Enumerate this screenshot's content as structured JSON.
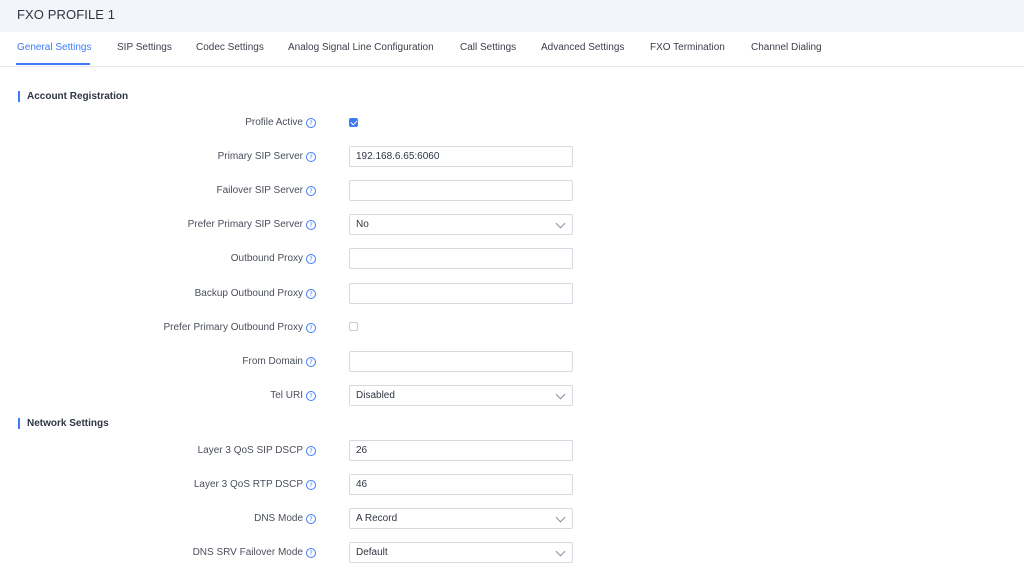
{
  "header": {
    "title": "FXO PROFILE 1"
  },
  "tabs": [
    {
      "label": "General Settings"
    },
    {
      "label": "SIP Settings"
    },
    {
      "label": "Codec Settings"
    },
    {
      "label": "Analog Signal Line Configuration"
    },
    {
      "label": "Call Settings"
    },
    {
      "label": "Advanced Settings"
    },
    {
      "label": "FXO Termination"
    },
    {
      "label": "Channel Dialing"
    }
  ],
  "sections": {
    "account": "Account Registration",
    "network": "Network Settings"
  },
  "fields": {
    "profile_active": {
      "label": "Profile Active",
      "checked": true
    },
    "primary_sip": {
      "label": "Primary SIP Server",
      "value": "192.168.6.65:6060"
    },
    "failover_sip": {
      "label": "Failover SIP Server",
      "value": ""
    },
    "prefer_primary_sip": {
      "label": "Prefer Primary SIP Server",
      "value": "No"
    },
    "outbound_proxy": {
      "label": "Outbound Proxy",
      "value": ""
    },
    "backup_outbound_proxy": {
      "label": "Backup Outbound Proxy",
      "value": ""
    },
    "prefer_primary_outbound": {
      "label": "Prefer Primary Outbound Proxy",
      "checked": false
    },
    "from_domain": {
      "label": "From Domain",
      "value": ""
    },
    "tel_uri": {
      "label": "Tel URI",
      "value": "Disabled"
    },
    "qos_sip": {
      "label": "Layer 3 QoS SIP DSCP",
      "value": "26"
    },
    "qos_rtp": {
      "label": "Layer 3 QoS RTP DSCP",
      "value": "46"
    },
    "dns_mode": {
      "label": "DNS Mode",
      "value": "A Record"
    },
    "dns_srv_failover": {
      "label": "DNS SRV Failover Mode",
      "value": "Default"
    }
  },
  "colors": {
    "accent": "#3e7bfa",
    "header_bg": "#f3f5fa"
  },
  "icons": {
    "help": "question-circle-icon",
    "dropdown": "chevron-down-icon"
  }
}
